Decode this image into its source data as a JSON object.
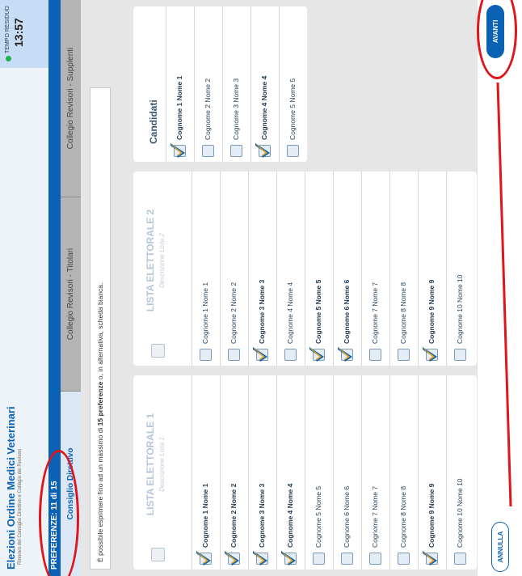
{
  "header": {
    "title": "Elezioni Ordine Medici Veterinari",
    "subtitle": "Rinnovo del Consiglio Direttivo e Collegio dei Revisori",
    "timer_label": "TEMPO RESIDUO",
    "timer_value": "13:57"
  },
  "preferences_label": "PREFERENZE: 11 di 15",
  "tabs": [
    {
      "label": "Consiglio Direttivo",
      "active": true
    },
    {
      "label": "Collegio Revisori - Titolari",
      "active": false
    },
    {
      "label": "Collegio Revisori - Supplenti",
      "active": false
    }
  ],
  "notice": {
    "before": "È possibile esprimere fino ad un massimo di ",
    "strong": "15 preferenze",
    "after": " o, in alternativa, scheda bianca."
  },
  "lists": [
    {
      "title": "LISTA ELETTORALE 1",
      "description": "Descrizione Lista 1",
      "candidates": [
        {
          "name": "Cognome 1 Nome 1",
          "checked": true
        },
        {
          "name": "Cognome 2 Nome 2",
          "checked": true
        },
        {
          "name": "Cognome 3 Nome 3",
          "checked": true
        },
        {
          "name": "Cognome 4 Nome 4",
          "checked": true
        },
        {
          "name": "Cognome 5 Nome 5",
          "checked": false
        },
        {
          "name": "Cognome 6 Nome 6",
          "checked": false
        },
        {
          "name": "Cognome 7 Nome 7",
          "checked": false
        },
        {
          "name": "Cognome 8 Nome 8",
          "checked": false
        },
        {
          "name": "Cognome 9 Nome 9",
          "checked": true
        },
        {
          "name": "Cognome 10 Nome 10",
          "checked": false
        }
      ]
    },
    {
      "title": "LISTA ELETTORALE 2",
      "description": "Descrizione Lista 2",
      "candidates": [
        {
          "name": "Cognome 1 Nome 1",
          "checked": false
        },
        {
          "name": "Cognome 2 Nome 2",
          "checked": false
        },
        {
          "name": "Cognome 3 Nome 3",
          "checked": true
        },
        {
          "name": "Cognome 4 Nome 4",
          "checked": false
        },
        {
          "name": "Cognome 5 Nome 5",
          "checked": true
        },
        {
          "name": "Cognome 6 Nome 6",
          "checked": true
        },
        {
          "name": "Cognome 7 Nome 7",
          "checked": false
        },
        {
          "name": "Cognome 8 Nome 8",
          "checked": false
        },
        {
          "name": "Cognome 9 Nome 9",
          "checked": true
        },
        {
          "name": "Cognome 10 Nome 10",
          "checked": false
        }
      ]
    }
  ],
  "independents": {
    "title": "Candidati",
    "candidates": [
      {
        "name": "Cognome 1 Nome 1",
        "checked": true
      },
      {
        "name": "Cognome 2 Nome 2",
        "checked": false
      },
      {
        "name": "Cognome 3 Nome 3",
        "checked": false
      },
      {
        "name": "Cognome 4 Nome 4",
        "checked": true
      },
      {
        "name": "Cognome 5 Nome 5",
        "checked": false
      }
    ]
  },
  "buttons": {
    "cancel": "ANNULLA",
    "next": "AVANTI"
  },
  "colors": {
    "primary": "#0b62b5",
    "check_accent": "#e8a317",
    "annotation": "#e0161b",
    "status_dot": "#22b14c"
  }
}
